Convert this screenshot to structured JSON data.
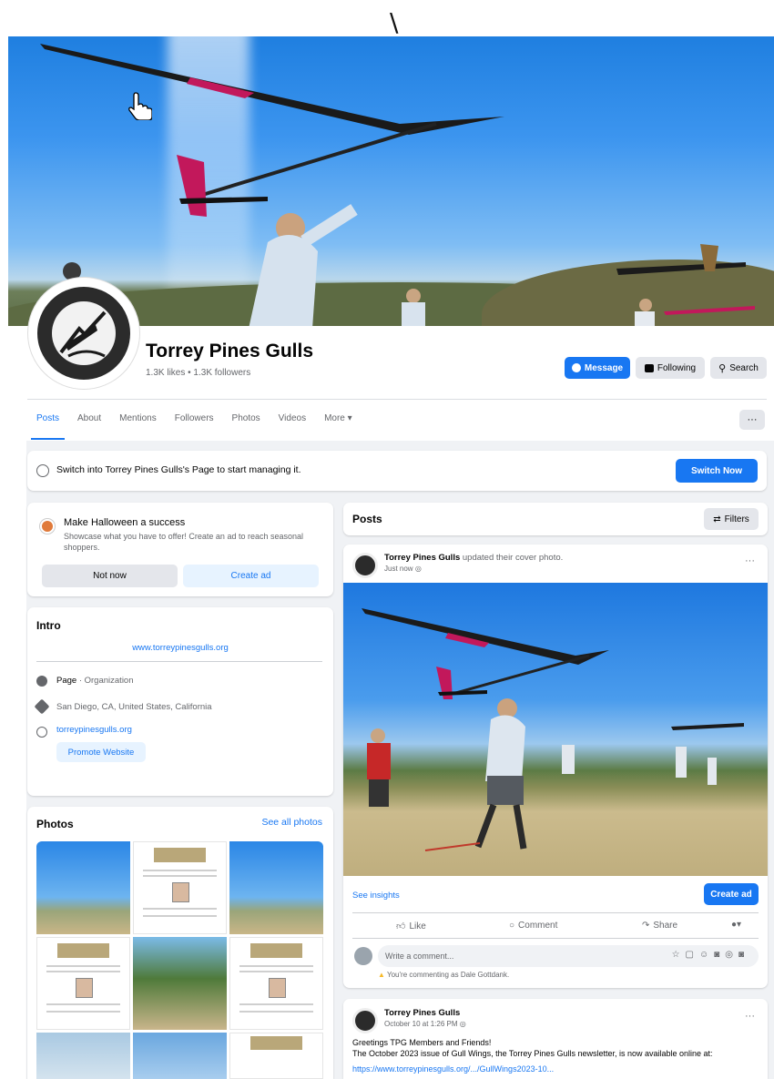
{
  "top_mark": "\\",
  "page": {
    "name": "Torrey Pines Gulls",
    "stats": "1.3K likes • 1.3K followers",
    "actions": {
      "message": "Message",
      "following": "Following",
      "search": "Search"
    }
  },
  "tabs": [
    {
      "label": "Posts"
    },
    {
      "label": "About"
    },
    {
      "label": "Mentions"
    },
    {
      "label": "Followers"
    },
    {
      "label": "Photos"
    },
    {
      "label": "Videos"
    },
    {
      "label": "More ▾"
    }
  ],
  "more_button": "···",
  "switch_banner": {
    "text": "Switch into Torrey Pines Gulls's Page to start managing it.",
    "button": "Switch Now"
  },
  "halloween": {
    "title": "Make Halloween a success",
    "body": "Showcase what you have to offer! Create an ad to reach seasonal shoppers.",
    "not_now": "Not now",
    "create_ad": "Create ad"
  },
  "intro": {
    "title": "Intro",
    "website_top": "www.torreypinesgulls.org",
    "category_bold": "Page",
    "category_rest": " · Organization",
    "location": "San Diego, CA, United States, California",
    "website": "torreypinesgulls.org",
    "promote": "Promote Website"
  },
  "photos": {
    "title": "Photos",
    "see_all": "See all photos"
  },
  "posts_header": {
    "title": "Posts",
    "filters": "Filters"
  },
  "post1": {
    "author": "Torrey Pines Gulls",
    "action": " updated their cover photo.",
    "time": "Just now",
    "see_insights": "See insights",
    "create_ad": "Create ad",
    "like": "Like",
    "comment": "Comment",
    "share": "Share",
    "comment_placeholder": "Write a comment...",
    "commenting_as": "You're commenting as Dale Gottdank."
  },
  "post2": {
    "author": "Torrey Pines Gulls",
    "time": "October 10 at 1:26 PM",
    "line1": "Greetings TPG Members and Friends!",
    "line2": "The October 2023 issue of Gull Wings, the Torrey Pines Gulls newsletter, is now available online at:",
    "link": "https://www.torreypinesgulls.org/.../GullWings2023-10..."
  },
  "colors": {
    "accent": "#1877f2",
    "feed_bg": "#f0f2f5",
    "muted": "#65676b"
  }
}
